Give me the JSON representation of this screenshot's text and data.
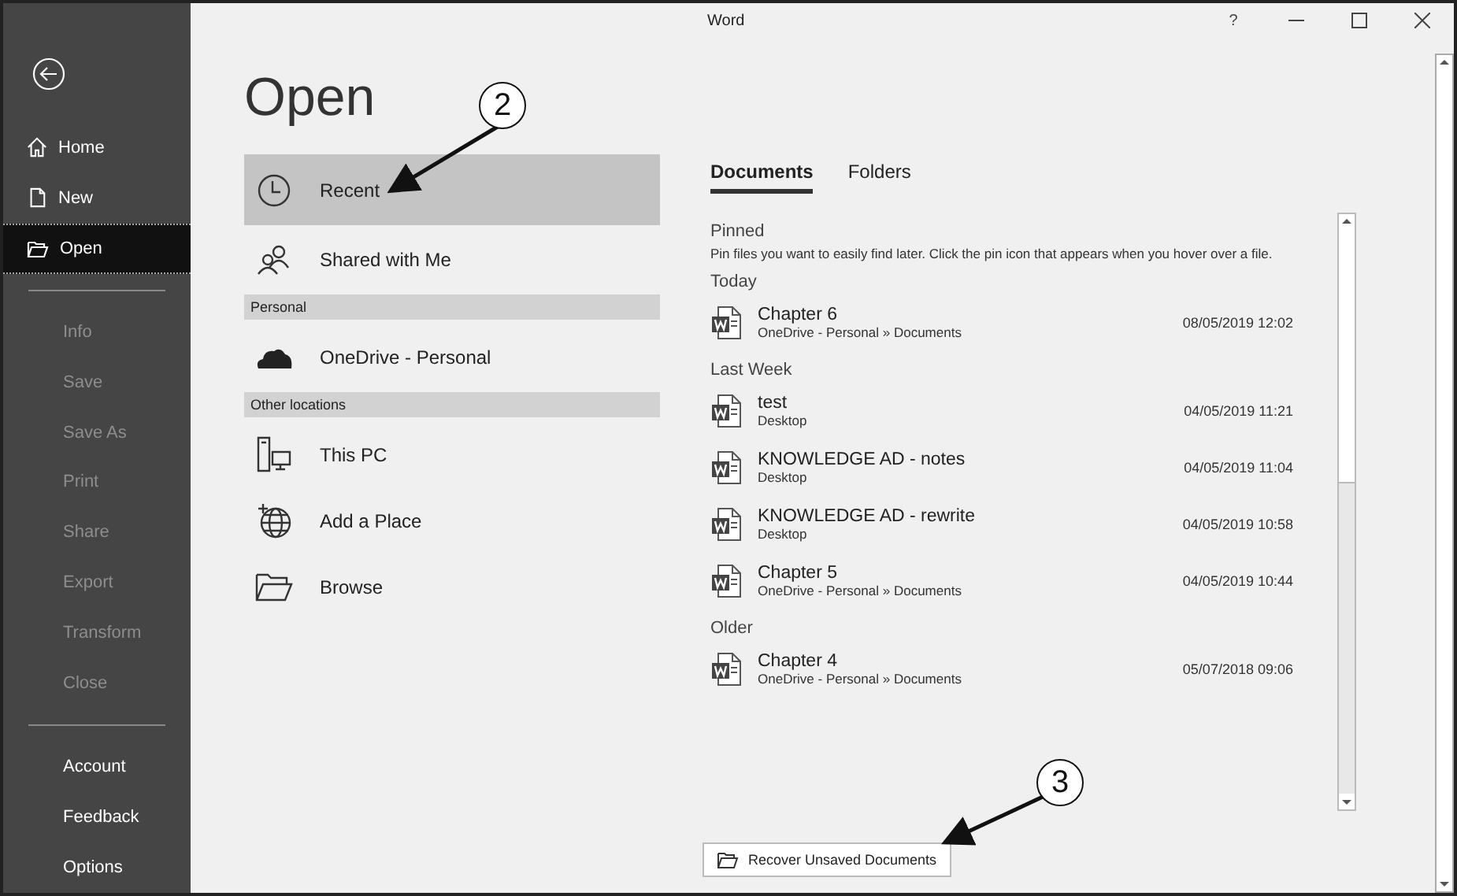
{
  "window": {
    "title": "Word",
    "help": "?"
  },
  "sidebar": {
    "groups": [
      [
        {
          "label": "Home",
          "selected": false,
          "disabled": false
        },
        {
          "label": "New",
          "selected": false,
          "disabled": false
        },
        {
          "label": "Open",
          "selected": true,
          "disabled": false
        }
      ],
      [
        {
          "label": "Info",
          "selected": false,
          "disabled": true
        },
        {
          "label": "Save",
          "selected": false,
          "disabled": true
        },
        {
          "label": "Save As",
          "selected": false,
          "disabled": true
        },
        {
          "label": "Print",
          "selected": false,
          "disabled": true
        },
        {
          "label": "Share",
          "selected": false,
          "disabled": true
        },
        {
          "label": "Export",
          "selected": false,
          "disabled": true
        },
        {
          "label": "Transform",
          "selected": false,
          "disabled": true
        },
        {
          "label": "Close",
          "selected": false,
          "disabled": true
        }
      ],
      [
        {
          "label": "Account",
          "selected": false,
          "disabled": false
        },
        {
          "label": "Feedback",
          "selected": false,
          "disabled": false
        },
        {
          "label": "Options",
          "selected": false,
          "disabled": false
        }
      ]
    ]
  },
  "page_title": "Open",
  "places": [
    {
      "kind": "place",
      "label": "Recent",
      "selected": true
    },
    {
      "kind": "place",
      "label": "Shared with Me",
      "selected": false
    },
    {
      "kind": "heading",
      "label": "Personal"
    },
    {
      "kind": "place",
      "label": "OneDrive - Personal",
      "selected": false
    },
    {
      "kind": "heading",
      "label": "Other locations"
    },
    {
      "kind": "place",
      "label": "This PC",
      "selected": false
    },
    {
      "kind": "place",
      "label": "Add a Place",
      "selected": false
    },
    {
      "kind": "place",
      "label": "Browse",
      "selected": false
    }
  ],
  "tabs": [
    {
      "label": "Documents",
      "selected": true
    },
    {
      "label": "Folders",
      "selected": false
    }
  ],
  "groups": [
    {
      "heading": "Pinned",
      "note": "Pin files you want to easily find later. Click the pin icon that appears when you hover over a file."
    },
    {
      "heading": "Today",
      "files": [
        {
          "name": "Chapter 6",
          "location": "OneDrive - Personal » Documents",
          "date": "08/05/2019 12:02"
        }
      ]
    },
    {
      "heading": "Last Week",
      "files": [
        {
          "name": "test",
          "location": "Desktop",
          "date": "04/05/2019 11:21"
        },
        {
          "name": "KNOWLEDGE AD - notes",
          "location": "Desktop",
          "date": "04/05/2019 11:04"
        },
        {
          "name": "KNOWLEDGE AD - rewrite",
          "location": "Desktop",
          "date": "04/05/2019 10:58"
        },
        {
          "name": "Chapter 5",
          "location": "OneDrive - Personal » Documents",
          "date": "04/05/2019 10:44"
        }
      ]
    },
    {
      "heading": "Older",
      "files": [
        {
          "name": "Chapter 4",
          "location": "OneDrive - Personal » Documents",
          "date": "05/07/2018 09:06"
        }
      ]
    }
  ],
  "recover_button": "Recover Unsaved Documents",
  "callouts": [
    "2",
    "3"
  ]
}
